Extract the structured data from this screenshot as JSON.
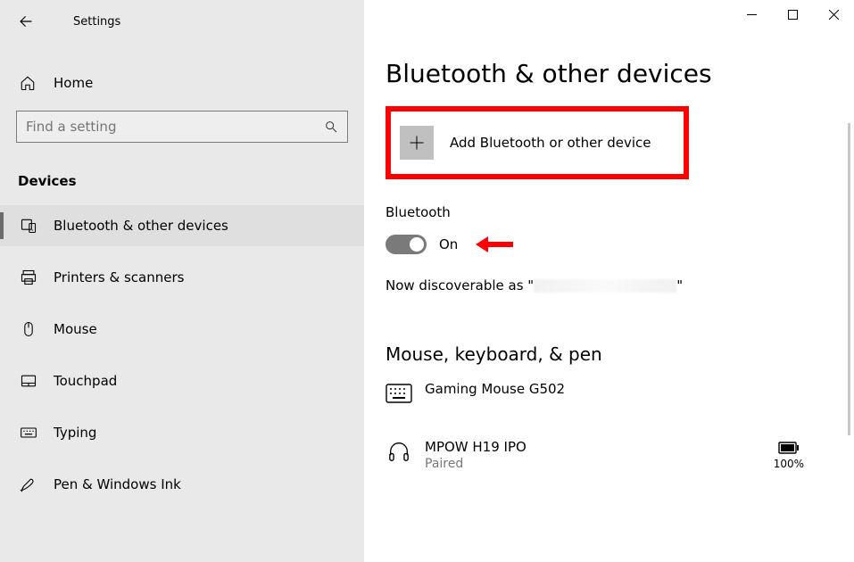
{
  "app_title": "Settings",
  "home_label": "Home",
  "search_placeholder": "Find a setting",
  "category_heading": "Devices",
  "nav": [
    {
      "label": "Bluetooth & other devices"
    },
    {
      "label": "Printers & scanners"
    },
    {
      "label": "Mouse"
    },
    {
      "label": "Touchpad"
    },
    {
      "label": "Typing"
    },
    {
      "label": "Pen & Windows Ink"
    }
  ],
  "page_title": "Bluetooth & other devices",
  "add_device_label": "Add Bluetooth or other device",
  "bluetooth_section_label": "Bluetooth",
  "toggle_state_label": "On",
  "discoverable_prefix": "Now discoverable as \"",
  "discoverable_suffix": "\"",
  "section_mouse_heading": "Mouse, keyboard, & pen",
  "devices": [
    {
      "name": "Gaming Mouse G502",
      "status": ""
    },
    {
      "name": "MPOW H19 IPO",
      "status": "Paired",
      "battery": "100%"
    }
  ]
}
